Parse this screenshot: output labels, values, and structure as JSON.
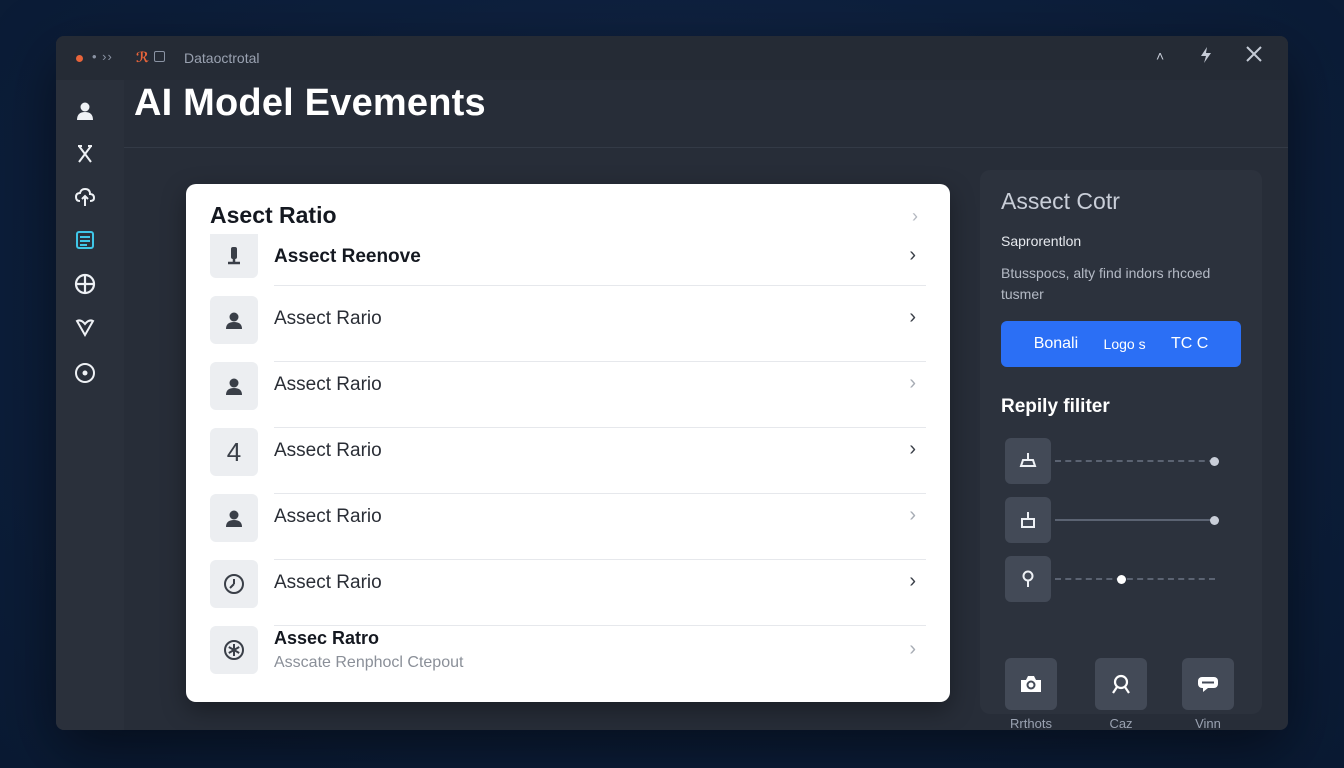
{
  "window": {
    "title": "Dataoctrotal",
    "controls": [
      "caret-up-icon",
      "bolt-icon",
      "close-icon"
    ]
  },
  "sidebar": {
    "items": [
      {
        "icon": "user-icon"
      },
      {
        "icon": "scissors-icon"
      },
      {
        "icon": "cloud-upload-icon"
      },
      {
        "icon": "list-icon",
        "active": true,
        "color": "#3fc6e8"
      },
      {
        "icon": "globe-icon"
      },
      {
        "icon": "heart-icon"
      },
      {
        "icon": "disc-icon"
      }
    ]
  },
  "page": {
    "title": "AI Model Evements"
  },
  "card": {
    "title": "Asect Ratio",
    "rows": [
      {
        "icon": "pin-icon",
        "label": "Assect Reenove",
        "bold": true
      },
      {
        "icon": "user-icon",
        "label": "Assect Rario"
      },
      {
        "icon": "user-icon",
        "label": "Assect Rario"
      },
      {
        "icon": "number-four-icon",
        "label": "Assect Rario"
      },
      {
        "icon": "user-icon",
        "label": "Assect Rario"
      },
      {
        "icon": "clock-icon",
        "label": "Assect Rario"
      },
      {
        "icon": "asterisk-icon",
        "label": "Assec Ratro",
        "bold": true,
        "sub": "Asscate Renphocl Ctepout"
      }
    ]
  },
  "panel": {
    "title": "Assect Cotr",
    "subtitle": "Saprorentlon",
    "description": "Btusspocs, alty find indors rhcoed tusmer",
    "button": {
      "left": "Bonali",
      "mid": "Logo s",
      "right": "TC C",
      "color": "#2b6ff5"
    },
    "filter_title": "Repily filiter",
    "sliders": [
      {
        "icon": "paint-icon",
        "style": "dashed",
        "value": 1.0
      },
      {
        "icon": "bucket-icon",
        "style": "solid",
        "value": 1.0
      },
      {
        "icon": "location-icon",
        "style": "dashed",
        "value": 0.4
      }
    ],
    "tiles": [
      {
        "icon": "camera-icon",
        "label": "Rrthots"
      },
      {
        "icon": "search-icon",
        "label": "Caz"
      },
      {
        "icon": "chat-icon",
        "label": "Vinn"
      }
    ]
  }
}
